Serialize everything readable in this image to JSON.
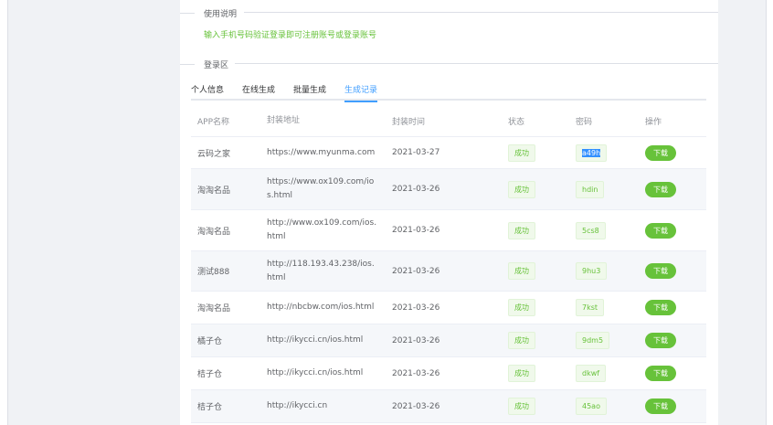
{
  "usage": {
    "title": "使用说明",
    "text": "输入手机号码验证登录即可注册账号或登录账号"
  },
  "login_area": {
    "title": "登录区"
  },
  "tabs": [
    {
      "label": "个人信息",
      "active": false
    },
    {
      "label": "在线生成",
      "active": false
    },
    {
      "label": "批量生成",
      "active": false
    },
    {
      "label": "生成记录",
      "active": true
    }
  ],
  "table": {
    "headers": [
      "APP名称",
      "封装地址",
      "封装时间",
      "状态",
      "密码",
      "操作"
    ],
    "rows": [
      {
        "name": "云码之家",
        "url": "https://www.myunma.com",
        "time": "2021-03-27",
        "status": "成功",
        "code": "a49h",
        "action": "下载"
      },
      {
        "name": "淘淘名品",
        "url": "https://www.ox109.com/ios.html",
        "time": "2021-03-26",
        "status": "成功",
        "code": "hdin",
        "action": "下载"
      },
      {
        "name": "淘淘名品",
        "url": "http://www.ox109.com/ios.html",
        "time": "2021-03-26",
        "status": "成功",
        "code": "5cs8",
        "action": "下载"
      },
      {
        "name": "测试888",
        "url": "http://118.193.43.238/ios.html",
        "time": "2021-03-26",
        "status": "成功",
        "code": "9hu3",
        "action": "下载"
      },
      {
        "name": "淘淘名品",
        "url": "http://nbcbw.com/ios.html",
        "time": "2021-03-26",
        "status": "成功",
        "code": "7kst",
        "action": "下载"
      },
      {
        "name": "橘子仓",
        "url": "http://ikycci.cn/ios.html",
        "time": "2021-03-26",
        "status": "成功",
        "code": "9dm5",
        "action": "下载"
      },
      {
        "name": "桔子仓",
        "url": "http://ikycci.cn/ios.html",
        "time": "2021-03-26",
        "status": "成功",
        "code": "dkwf",
        "action": "下载"
      },
      {
        "name": "桔子仓",
        "url": "http://ikycci.cn",
        "time": "2021-03-26",
        "status": "成功",
        "code": "45ao",
        "action": "下载"
      }
    ]
  },
  "colors": {
    "success_green": "#67c23a",
    "tab_active_blue": "#409eff",
    "selection_blue": "#3390ff"
  }
}
